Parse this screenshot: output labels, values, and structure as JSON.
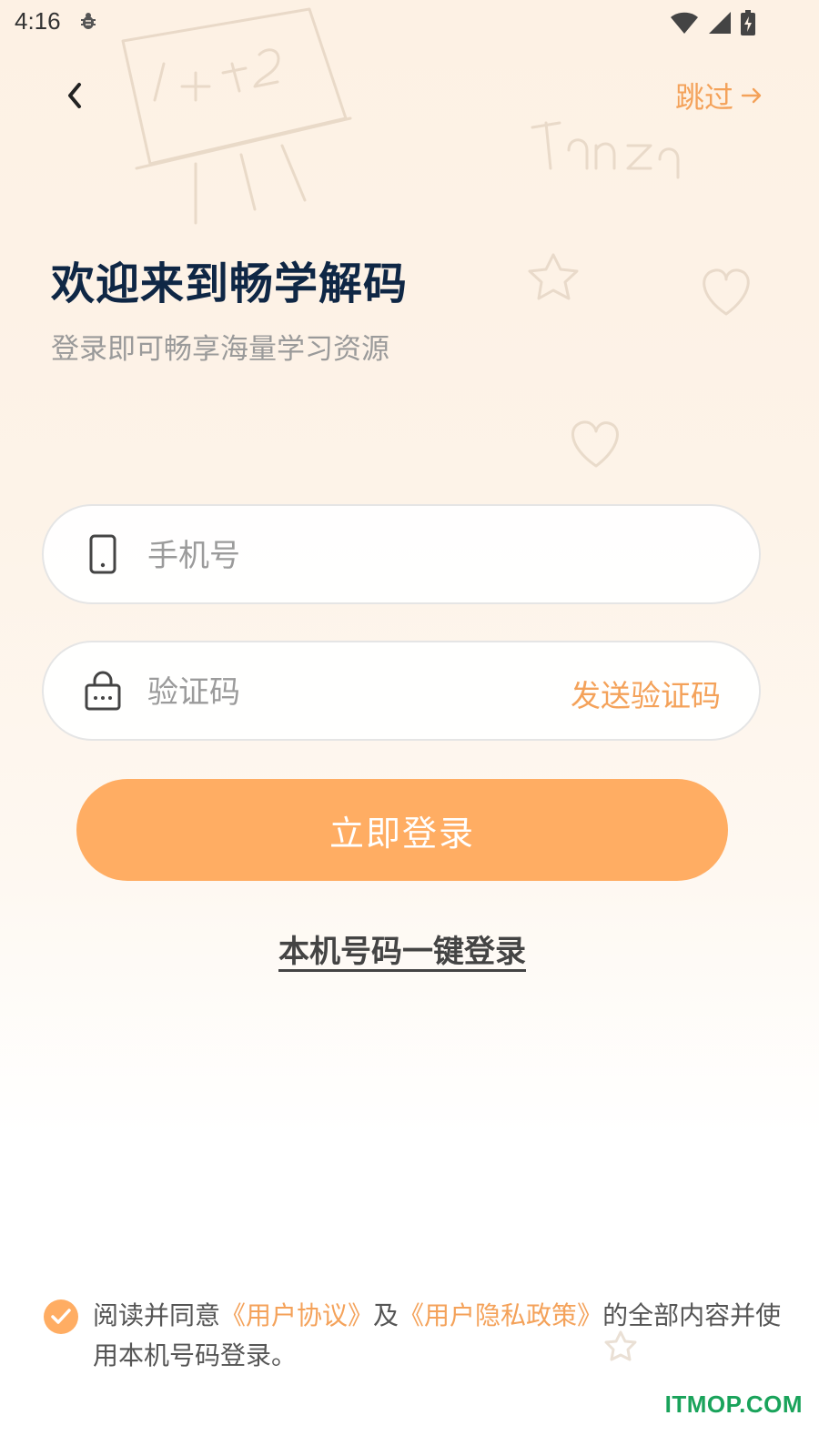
{
  "status_bar": {
    "time": "4:16",
    "icons": [
      "bug-icon",
      "wifi-icon",
      "signal-icon",
      "battery-charging-icon"
    ]
  },
  "header": {
    "back_icon": "chevron-left-icon",
    "skip_label": "跳过",
    "skip_icon": "arrow-right-icon"
  },
  "hero": {
    "title": "欢迎来到畅学解码",
    "subtitle": "登录即可畅享海量学习资源"
  },
  "form": {
    "phone": {
      "placeholder": "手机号",
      "value": "",
      "icon": "phone-icon"
    },
    "code": {
      "placeholder": "验证码",
      "value": "",
      "icon": "lock-icon",
      "send_label": "发送验证码"
    },
    "login_label": "立即登录",
    "one_click_label": "本机号码一键登录"
  },
  "agreement": {
    "checked": true,
    "prefix": "阅读并同意",
    "user_agreement": "《用户协议》",
    "conj": "及",
    "privacy_policy": "《用户隐私政策》",
    "suffix": "的全部内容并使用本机号码登录。"
  },
  "watermark": "ITMOP.COM",
  "colors": {
    "accent": "#f4a25a",
    "button": "#ffad63",
    "title": "#0f2745",
    "watermark": "#1aa35b"
  }
}
